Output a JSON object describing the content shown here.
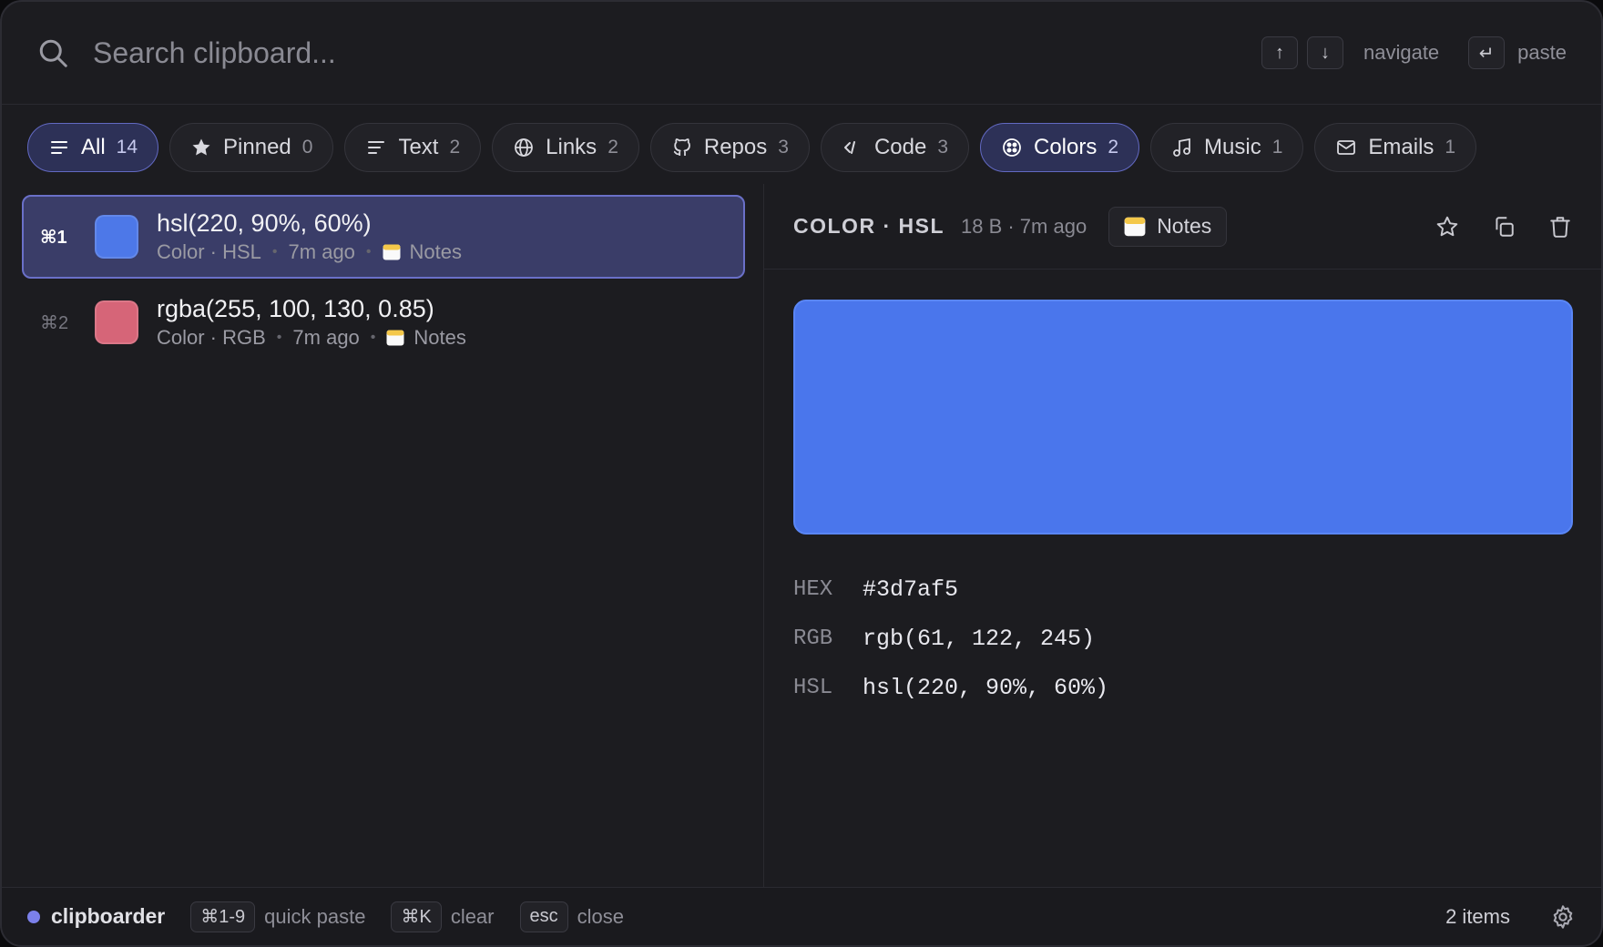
{
  "search": {
    "placeholder": "Search clipboard...",
    "hints": {
      "navigate": "navigate",
      "paste": "paste",
      "up_key": "↑",
      "down_key": "↓",
      "enter_key": "↵"
    }
  },
  "filters": [
    {
      "label": "All",
      "count": "14",
      "icon": "list-icon",
      "active": true
    },
    {
      "label": "Pinned",
      "count": "0",
      "icon": "star-icon",
      "active": false
    },
    {
      "label": "Text",
      "count": "2",
      "icon": "text-icon",
      "active": false
    },
    {
      "label": "Links",
      "count": "2",
      "icon": "globe-icon",
      "active": false
    },
    {
      "label": "Repos",
      "count": "3",
      "icon": "github-icon",
      "active": false
    },
    {
      "label": "Code",
      "count": "3",
      "icon": "code-icon",
      "active": false
    },
    {
      "label": "Colors",
      "count": "2",
      "icon": "palette-icon",
      "active": true
    },
    {
      "label": "Music",
      "count": "1",
      "icon": "music-note-icon",
      "active": false
    },
    {
      "label": "Emails",
      "count": "1",
      "icon": "mail-icon",
      "active": false
    }
  ],
  "items": [
    {
      "shortcut": "⌘1",
      "title": "hsl(220, 90%, 60%)",
      "kind": "Color · HSL",
      "time": "7m ago",
      "source": "Notes",
      "swatch": "#4d78e8",
      "selected": true
    },
    {
      "shortcut": "⌘2",
      "title": "rgba(255, 100, 130, 0.85)",
      "kind": "Color · RGB",
      "time": "7m ago",
      "source": "Notes",
      "swatch": "#d66578",
      "selected": false
    }
  ],
  "detail": {
    "kind": "COLOR · HSL",
    "meta": "18 B · 7m ago",
    "source": "Notes",
    "preview_color": "#4a76ec",
    "values": [
      {
        "label": "HEX",
        "value": "#3d7af5"
      },
      {
        "label": "RGB",
        "value": "rgb(61, 122, 245)"
      },
      {
        "label": "HSL",
        "value": "hsl(220, 90%, 60%)"
      }
    ]
  },
  "footer": {
    "app_name": "clipboarder",
    "shortcuts": [
      {
        "key": "⌘1-9",
        "label": "quick paste"
      },
      {
        "key": "⌘K",
        "label": "clear"
      },
      {
        "key": "esc",
        "label": "close"
      }
    ],
    "items_count": "2 items"
  },
  "colors": {
    "accent": "#7b80ea",
    "selected_bg": "#3a3d68",
    "notes_icon": "#f4c84a"
  }
}
